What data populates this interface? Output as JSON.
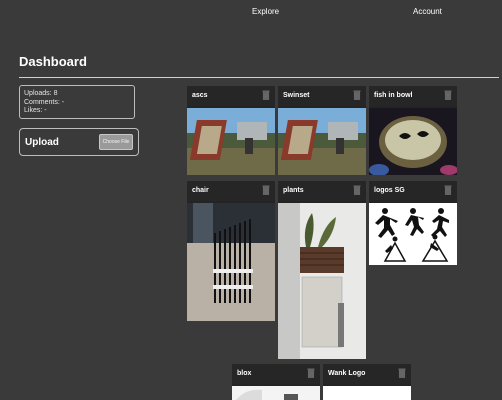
{
  "nav": {
    "explore": "Explore",
    "account": "Account"
  },
  "page_title": "Dashboard",
  "stats": {
    "uploads": "Uploads: 8",
    "comments": "Comments: -",
    "likes": "Likes: -"
  },
  "upload": {
    "title": "Upload",
    "button": "Choose File"
  },
  "cards": [
    {
      "title": "ascs"
    },
    {
      "title": "Swinset"
    },
    {
      "title": "fish in bowl"
    },
    {
      "title": "chair"
    },
    {
      "title": "plants"
    },
    {
      "title": "logos SG"
    },
    {
      "title": "blox"
    },
    {
      "title": "Wank Logo"
    }
  ],
  "icons": {
    "delete": "trash-icon"
  },
  "colors": {
    "background": "#3a3a3a",
    "card_header": "#262626",
    "button": "#9a9a9a"
  }
}
